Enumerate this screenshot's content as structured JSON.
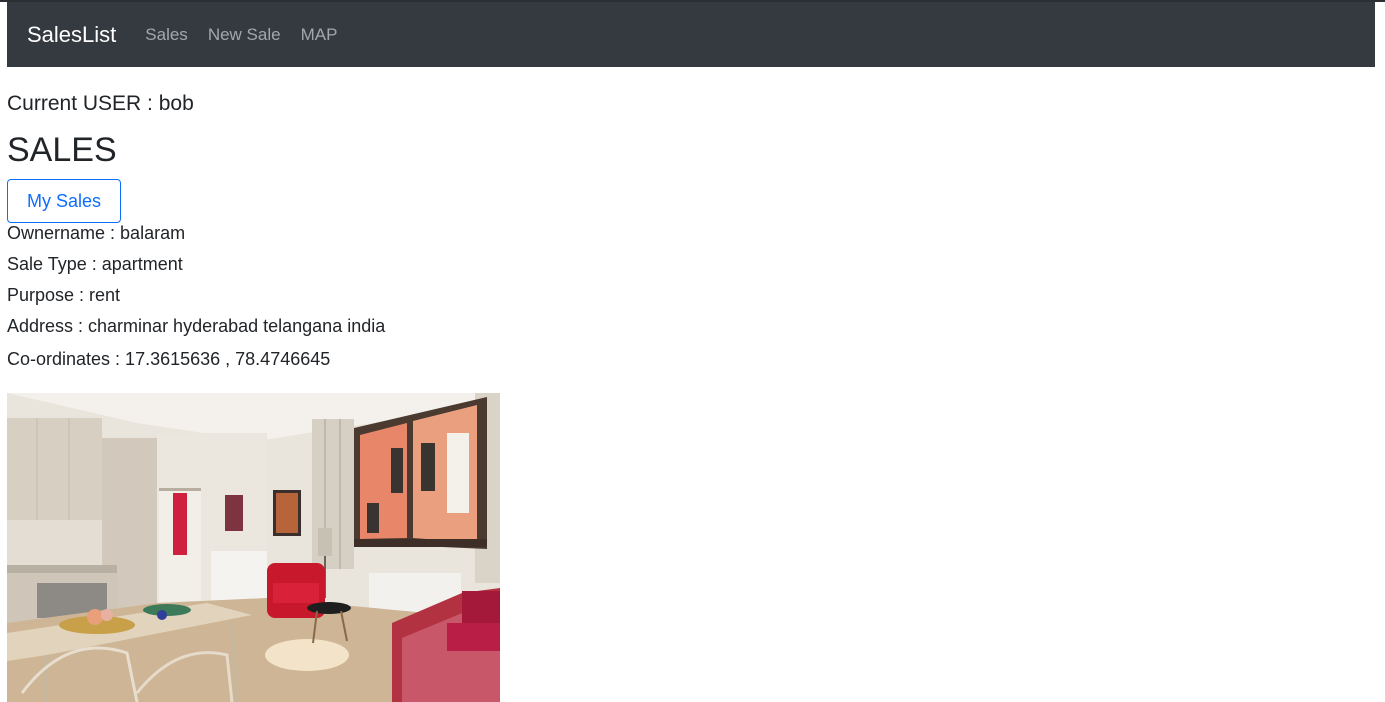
{
  "navbar": {
    "brand": "SalesList",
    "links": [
      "Sales",
      "New Sale",
      "MAP"
    ]
  },
  "user": {
    "line": "Current USER : bob"
  },
  "page_title": "SALES",
  "my_sales_button": "My Sales",
  "sale": {
    "owner": "Ownername : balaram",
    "type": "Sale Type : apartment",
    "purpose": "Purpose : rent",
    "address": "Address : charminar hyderabad telangana india",
    "coordinates": "Co-ordinates : 17.3615636 , 78.4746645"
  },
  "colors": {
    "navbar_bg": "#343a40",
    "accent": "#0d6efd"
  }
}
